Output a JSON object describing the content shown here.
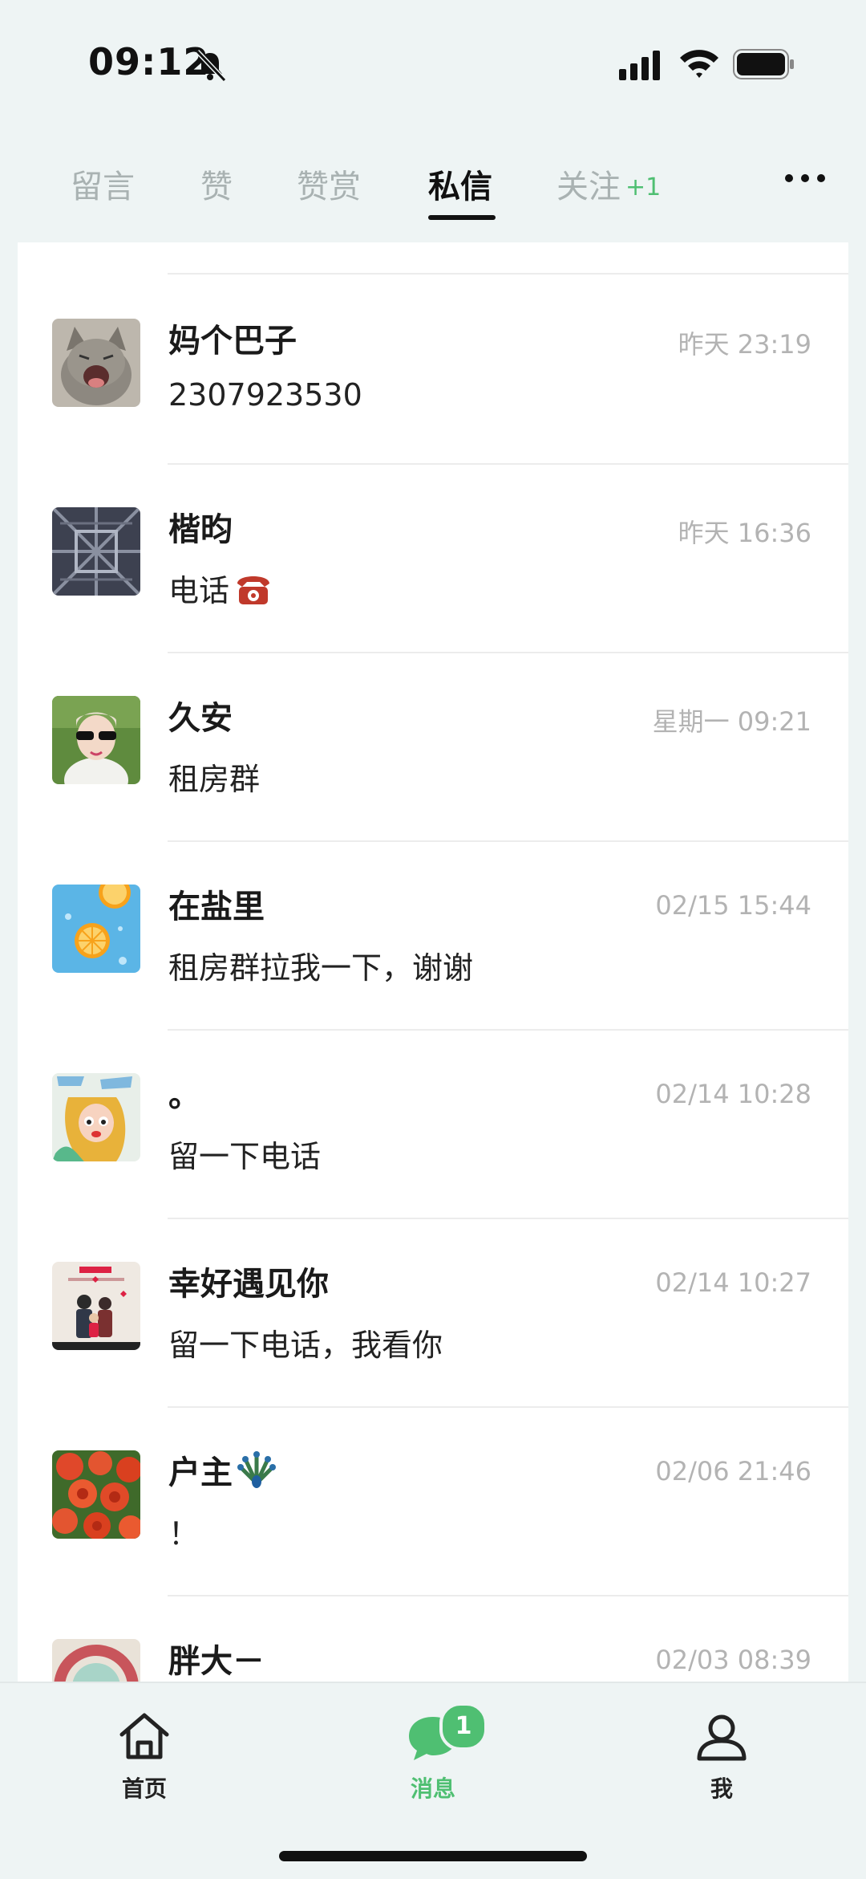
{
  "status_bar": {
    "time": "09:12",
    "icons": [
      "bell-mute-icon",
      "cellular-signal-icon",
      "wifi-icon",
      "battery-icon"
    ]
  },
  "tabs": [
    {
      "label": "留言",
      "active": false
    },
    {
      "label": "赞",
      "active": false
    },
    {
      "label": "赞赏",
      "active": false
    },
    {
      "label": "私信",
      "active": true
    },
    {
      "label": "关注",
      "active": false,
      "badge": "+1"
    }
  ],
  "messages": [
    {
      "name": "妈个巴子",
      "time": "昨天 23:19",
      "preview": "2307923530",
      "avatar": "cat-avatar"
    },
    {
      "name": "楷昀",
      "time": "昨天 16:36",
      "preview": "电话",
      "preview_emoji": "telephone-emoji",
      "avatar": "steel-tower-avatar"
    },
    {
      "name": "久安",
      "time": "星期一 09:21",
      "preview": "租房群",
      "avatar": "girl-sunglasses-avatar"
    },
    {
      "name": "在盐里",
      "time": "02/15 15:44",
      "preview": "租房群拉我一下，谢谢",
      "avatar": "orange-slices-avatar"
    },
    {
      "name": "。",
      "time": "02/14 10:28",
      "preview": "留一下电话",
      "avatar": "cartoon-girl-avatar"
    },
    {
      "name": "幸好遇见你",
      "time": "02/14 10:27",
      "preview": "留一下电话，我看你",
      "avatar": "family-poster-avatar"
    },
    {
      "name": "户主",
      "name_emoji": "peacock-emoji",
      "time": "02/06 21:46",
      "preview": "！",
      "avatar": "red-roses-avatar"
    },
    {
      "name": "胖大－",
      "time": "02/03 08:39",
      "preview": "",
      "avatar": "ring-avatar"
    }
  ],
  "bottom_nav": [
    {
      "label": "首页",
      "icon": "home-icon",
      "active": false
    },
    {
      "label": "消息",
      "icon": "chat-bubble-icon",
      "active": true,
      "badge": "1"
    },
    {
      "label": "我",
      "icon": "person-icon",
      "active": false
    }
  ],
  "colors": {
    "accent": "#4fbf72",
    "background": "#eef4f4",
    "card": "#ffffff",
    "muted": "#b3b3b3"
  }
}
